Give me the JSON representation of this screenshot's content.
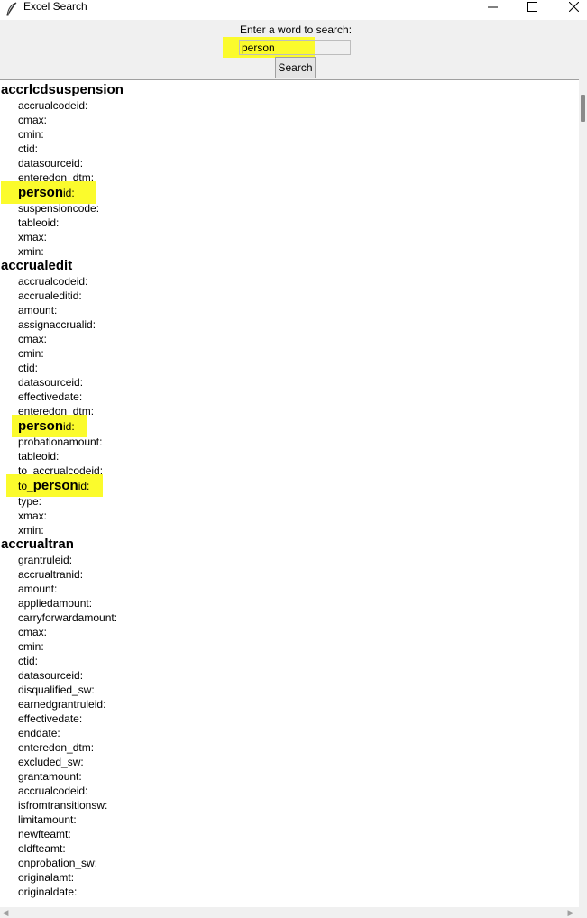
{
  "window": {
    "title": "Excel Search",
    "minimize_glyph": "—",
    "maximize_glyph": "☐",
    "close_glyph": "✕",
    "icon": "feather-icon"
  },
  "search": {
    "label": "Enter a word to search:",
    "value": "person",
    "button_label": "Search"
  },
  "highlight_color": "#fbfb2c",
  "results": {
    "tables": [
      {
        "name": "accrlcdsuspension",
        "fields": [
          {
            "pre": "accrualcodeid:",
            "match": "",
            "post": ""
          },
          {
            "pre": "cmax:",
            "match": "",
            "post": ""
          },
          {
            "pre": "cmin:",
            "match": "",
            "post": ""
          },
          {
            "pre": "ctid:",
            "match": "",
            "post": ""
          },
          {
            "pre": "datasourceid:",
            "match": "",
            "post": ""
          },
          {
            "pre": "enteredon_dtm:",
            "match": "",
            "post": ""
          },
          {
            "pre": "",
            "match": "person",
            "post": "id:"
          },
          {
            "pre": "suspensioncode:",
            "match": "",
            "post": ""
          },
          {
            "pre": "tableoid:",
            "match": "",
            "post": ""
          },
          {
            "pre": "xmax:",
            "match": "",
            "post": ""
          },
          {
            "pre": "xmin:",
            "match": "",
            "post": ""
          }
        ]
      },
      {
        "name": "accrualedit",
        "fields": [
          {
            "pre": "accrualcodeid:",
            "match": "",
            "post": ""
          },
          {
            "pre": "accrualeditid:",
            "match": "",
            "post": ""
          },
          {
            "pre": "amount:",
            "match": "",
            "post": ""
          },
          {
            "pre": "assignaccrualid:",
            "match": "",
            "post": ""
          },
          {
            "pre": "cmax:",
            "match": "",
            "post": ""
          },
          {
            "pre": "cmin:",
            "match": "",
            "post": ""
          },
          {
            "pre": "ctid:",
            "match": "",
            "post": ""
          },
          {
            "pre": "datasourceid:",
            "match": "",
            "post": ""
          },
          {
            "pre": "effectivedate:",
            "match": "",
            "post": ""
          },
          {
            "pre": "enteredon_dtm:",
            "match": "",
            "post": ""
          },
          {
            "pre": "",
            "match": "person",
            "post": "id:"
          },
          {
            "pre": "probationamount:",
            "match": "",
            "post": ""
          },
          {
            "pre": "tableoid:",
            "match": "",
            "post": ""
          },
          {
            "pre": "to_accrualcodeid:",
            "match": "",
            "post": ""
          },
          {
            "pre": "to_",
            "match": "person",
            "post": "id:"
          },
          {
            "pre": "type:",
            "match": "",
            "post": ""
          },
          {
            "pre": "xmax:",
            "match": "",
            "post": ""
          },
          {
            "pre": "xmin:",
            "match": "",
            "post": ""
          }
        ]
      },
      {
        "name": "accrualtran",
        "fields": [
          {
            "pre": "grantruleid:",
            "match": "",
            "post": ""
          },
          {
            "pre": "accrualtranid:",
            "match": "",
            "post": ""
          },
          {
            "pre": "amount:",
            "match": "",
            "post": ""
          },
          {
            "pre": "appliedamount:",
            "match": "",
            "post": ""
          },
          {
            "pre": "carryforwardamount:",
            "match": "",
            "post": ""
          },
          {
            "pre": "cmax:",
            "match": "",
            "post": ""
          },
          {
            "pre": "cmin:",
            "match": "",
            "post": ""
          },
          {
            "pre": "ctid:",
            "match": "",
            "post": ""
          },
          {
            "pre": "datasourceid:",
            "match": "",
            "post": ""
          },
          {
            "pre": "disqualified_sw:",
            "match": "",
            "post": ""
          },
          {
            "pre": "earnedgrantruleid:",
            "match": "",
            "post": ""
          },
          {
            "pre": "effectivedate:",
            "match": "",
            "post": ""
          },
          {
            "pre": "enddate:",
            "match": "",
            "post": ""
          },
          {
            "pre": "enteredon_dtm:",
            "match": "",
            "post": ""
          },
          {
            "pre": "excluded_sw:",
            "match": "",
            "post": ""
          },
          {
            "pre": "grantamount:",
            "match": "",
            "post": ""
          },
          {
            "pre": "accrualcodeid:",
            "match": "",
            "post": ""
          },
          {
            "pre": "isfromtransitionsw:",
            "match": "",
            "post": ""
          },
          {
            "pre": "limitamount:",
            "match": "",
            "post": ""
          },
          {
            "pre": "newfteamt:",
            "match": "",
            "post": ""
          },
          {
            "pre": "oldfteamt:",
            "match": "",
            "post": ""
          },
          {
            "pre": "onprobation_sw:",
            "match": "",
            "post": ""
          },
          {
            "pre": "originalamt:",
            "match": "",
            "post": ""
          },
          {
            "pre": "originaldate:",
            "match": "",
            "post": ""
          }
        ]
      }
    ]
  },
  "scrollbars": {
    "left_arrow": "◀",
    "right_arrow": "▶"
  }
}
